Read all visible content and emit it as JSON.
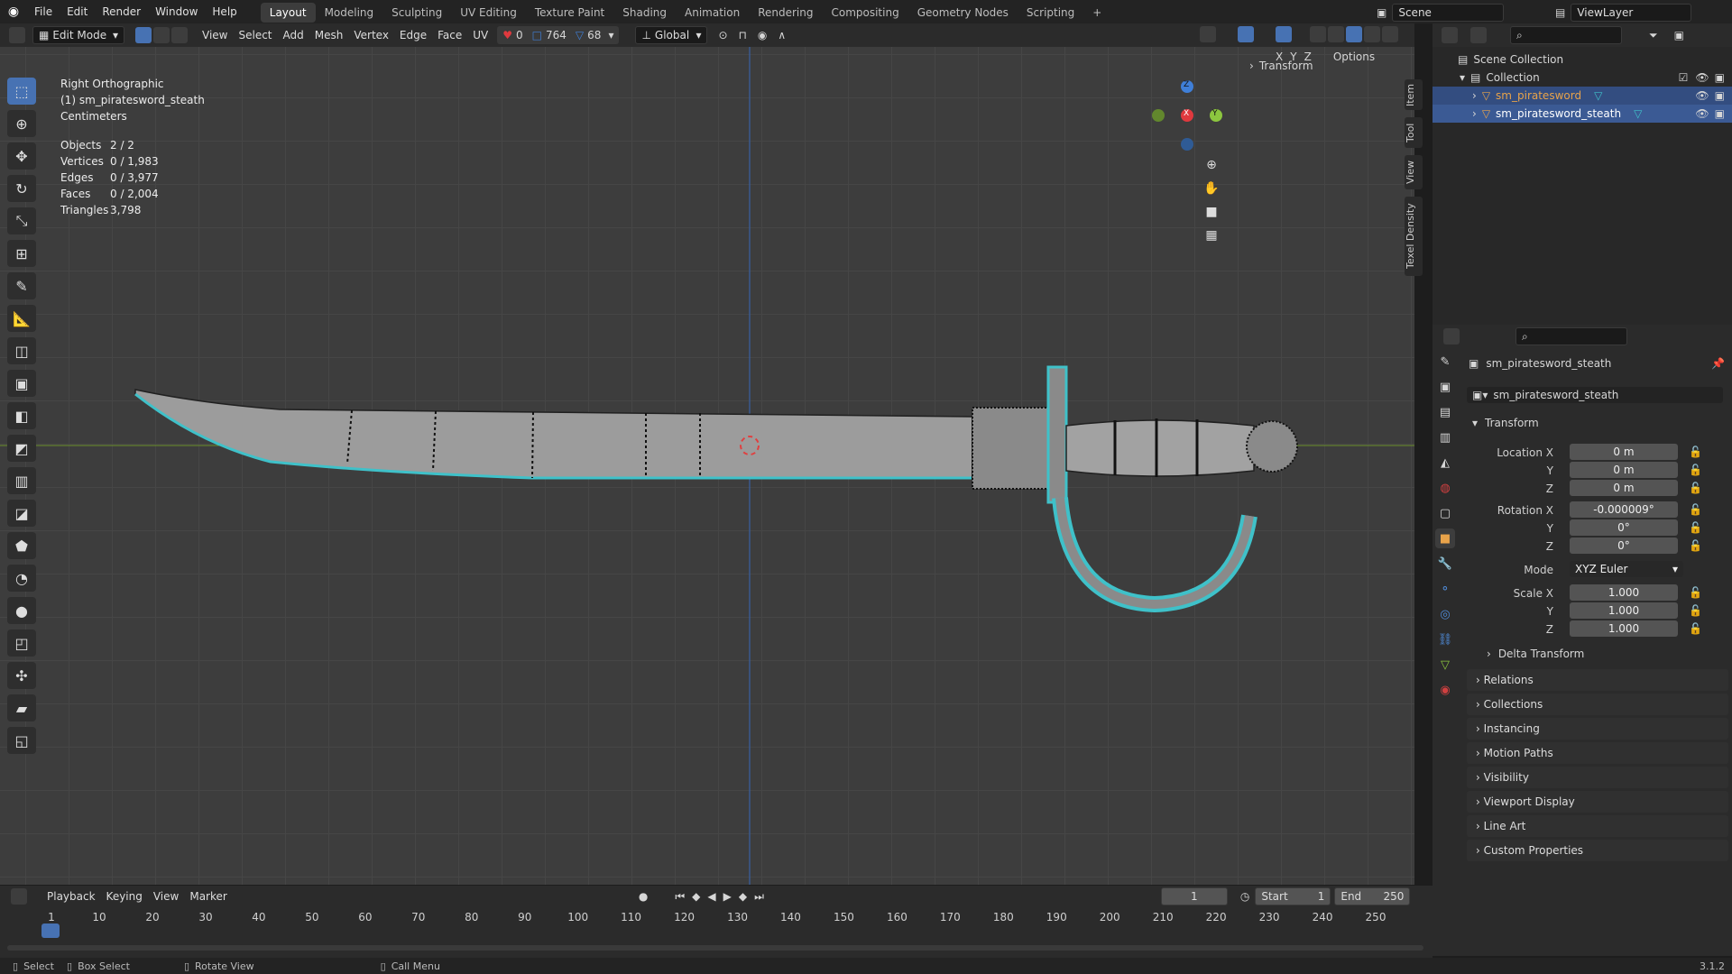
{
  "menus": [
    "File",
    "Edit",
    "Render",
    "Window",
    "Help"
  ],
  "workspaces": [
    "Layout",
    "Modeling",
    "Sculpting",
    "UV Editing",
    "Texture Paint",
    "Shading",
    "Animation",
    "Rendering",
    "Compositing",
    "Geometry Nodes",
    "Scripting"
  ],
  "active_workspace": "Layout",
  "scene_name": "Scene",
  "view_layer": "ViewLayer",
  "header": {
    "mode": "Edit Mode",
    "menus": [
      "View",
      "Select",
      "Add",
      "Mesh",
      "Vertex",
      "Edge",
      "Face",
      "UV"
    ],
    "stats": {
      "a": "0",
      "b": "764",
      "c": "68"
    },
    "orientation": "Global",
    "options": "Options",
    "axes": [
      "X",
      "Y",
      "Z"
    ]
  },
  "viewport_info": {
    "view_name": "Right Orthographic",
    "object_line": "(1) sm_piratesword_steath",
    "units": "Centimeters",
    "stats": [
      {
        "label": "Objects",
        "value": "2 / 2"
      },
      {
        "label": "Vertices",
        "value": "0 / 1,983"
      },
      {
        "label": "Edges",
        "value": "0 / 3,977"
      },
      {
        "label": "Faces",
        "value": "0 / 2,004"
      },
      {
        "label": "Triangles",
        "value": "3,798"
      }
    ],
    "transform_panel": "Transform",
    "gizmo": {
      "x": "X",
      "y": "Y",
      "z": "Z"
    }
  },
  "side_tabs": [
    "Item",
    "Tool",
    "View",
    "Texel Density"
  ],
  "outliner": {
    "root": "Scene Collection",
    "collection": "Collection",
    "items": [
      "sm_piratesword",
      "sm_piratesword_steath"
    ]
  },
  "properties": {
    "object_name": "sm_piratesword_steath",
    "object_dropdown": "sm_piratesword_steath",
    "transform_title": "Transform",
    "location": {
      "label_x": "Location X",
      "x": "0 m",
      "y": "0 m",
      "z": "0 m"
    },
    "rotation": {
      "label_x": "Rotation X",
      "x": "-0.000009°",
      "y": "0°",
      "z": "0°"
    },
    "mode_label": "Mode",
    "mode_value": "XYZ Euler",
    "scale": {
      "label_x": "Scale X",
      "x": "1.000",
      "y": "1.000",
      "z": "1.000"
    },
    "axis_y": "Y",
    "axis_z": "Z",
    "delta": "Delta Transform",
    "sections": [
      "Relations",
      "Collections",
      "Instancing",
      "Motion Paths",
      "Visibility",
      "Viewport Display",
      "Line Art",
      "Custom Properties"
    ]
  },
  "timeline": {
    "menus": [
      "Playback",
      "Keying",
      "View",
      "Marker"
    ],
    "current_frame": "1",
    "start_label": "Start",
    "start": "1",
    "end_label": "End",
    "end": "250",
    "ticks": [
      "1",
      "10",
      "20",
      "30",
      "40",
      "50",
      "60",
      "70",
      "80",
      "90",
      "100",
      "110",
      "120",
      "130",
      "140",
      "150",
      "160",
      "170",
      "180",
      "190",
      "200",
      "210",
      "220",
      "230",
      "240",
      "250"
    ]
  },
  "statusbar": {
    "select": "Select",
    "box_select": "Box Select",
    "rotate": "Rotate View",
    "call_menu": "Call Menu",
    "version": "3.1.2"
  },
  "colors": {
    "accent": "#4772b3",
    "selected_edge": "#3fc1c9",
    "x_axis": "#e0393e",
    "y_axis": "#8cc63f",
    "z_axis": "#3f7fd8",
    "orange": "#e8a34a"
  }
}
